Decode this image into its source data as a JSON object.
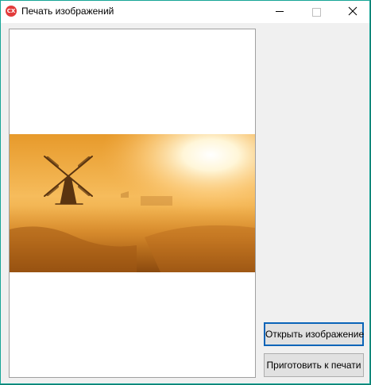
{
  "window": {
    "title": "Печать изображений",
    "app_icon_text": "CX"
  },
  "buttons": {
    "open_label": "Открыть изображение",
    "prepare_label": "Приготовить к печати"
  },
  "icons": {
    "app": "app-logo-icon",
    "minimize": "minimize-icon",
    "maximize": "maximize-icon",
    "close": "close-icon",
    "windmill": "windmill-silhouette"
  },
  "colors": {
    "window_border": "#17a597",
    "focus_border": "#0a64b8",
    "app_icon": "#e23b3b"
  }
}
